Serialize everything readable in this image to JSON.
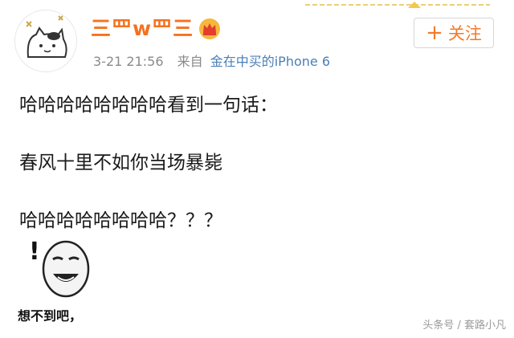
{
  "user": {
    "name": "三罒w罒三"
  },
  "follow": {
    "plus": "+",
    "label": "关注"
  },
  "meta": {
    "time": "3-21 21:56",
    "source_label": "来自",
    "device": "金在中买的iPhone 6"
  },
  "post": {
    "line1": "哈哈哈哈哈哈哈哈看到一句话：",
    "line2": "春风十里不如你当场暴毙",
    "line3": "哈哈哈哈哈哈哈哈？？？"
  },
  "sticker": {
    "exclaim": "!",
    "caption": "想不到吧，"
  },
  "watermark": "头条号 / 套路小凡",
  "colors": {
    "accent": "#f4721f",
    "link": "#4a7fb5",
    "meta": "#8a8a8a"
  }
}
